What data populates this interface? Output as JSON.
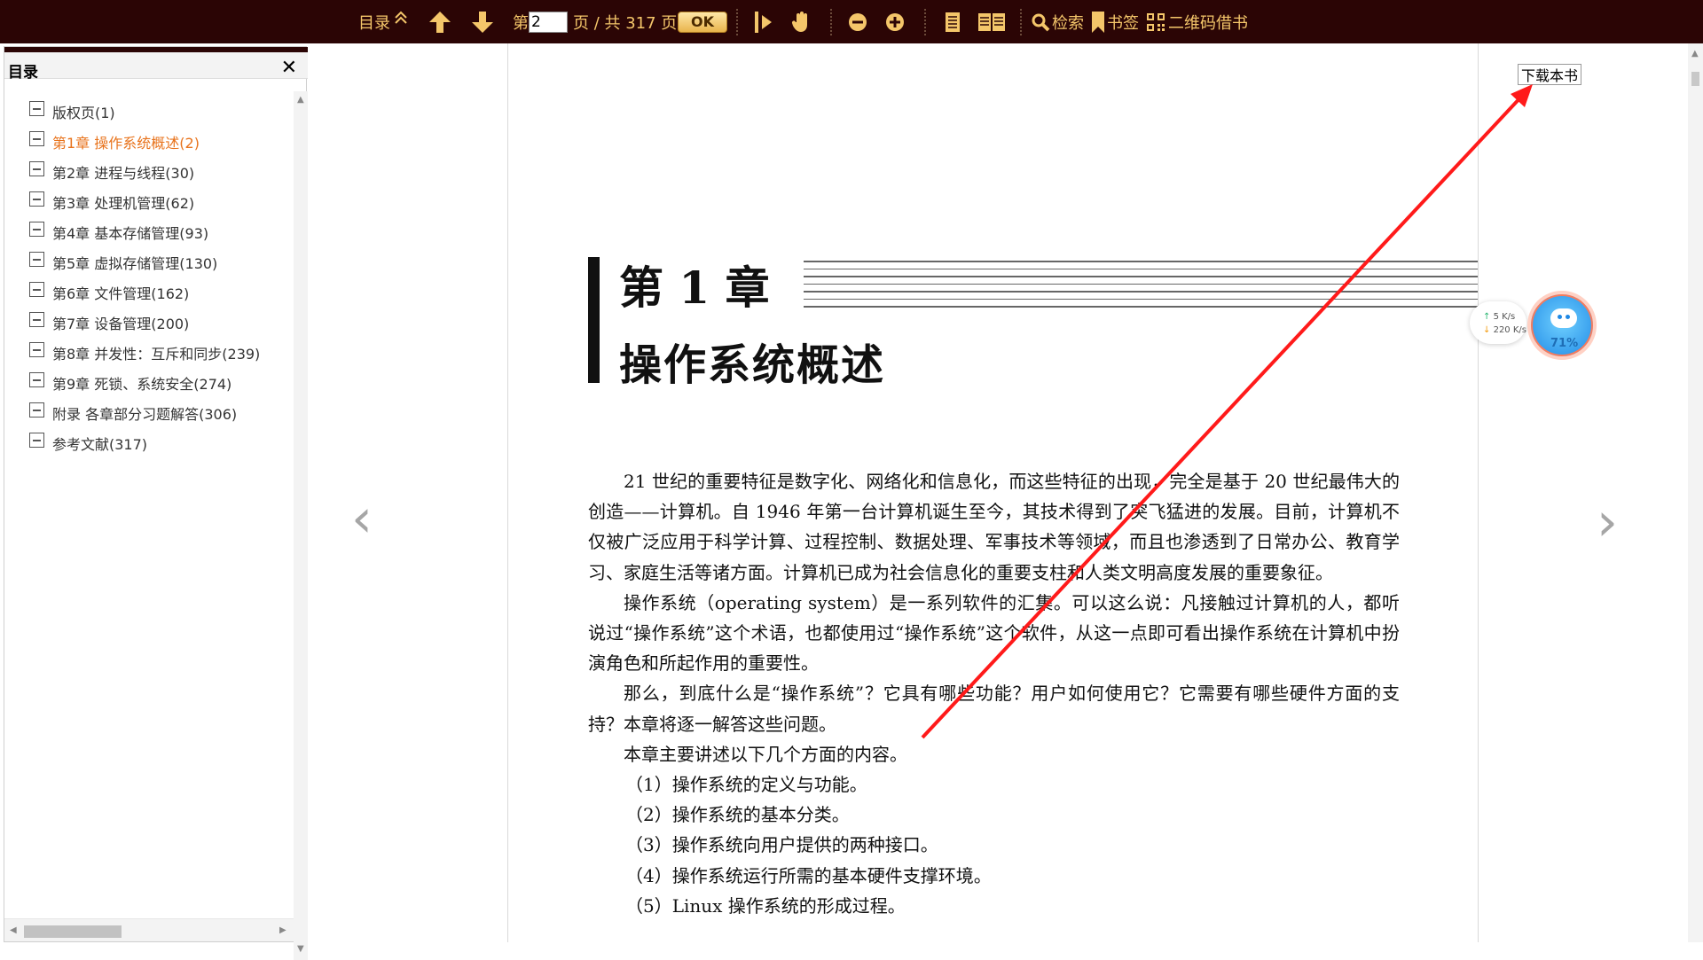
{
  "toolbar": {
    "toc_label": "目录",
    "page_prefix": "第",
    "current_page": "2",
    "page_total_text": "页 / 共 317 页",
    "ok_label": "OK",
    "search_label": "检索",
    "bookmark_label": "书签",
    "qr_label": "二维码借书",
    "icons": [
      "collapse-up-icon",
      "arrow-up-icon",
      "arrow-down-icon",
      "text-select-icon",
      "hand-pan-icon",
      "zoom-out-icon",
      "zoom-in-icon",
      "single-page-icon",
      "double-page-icon",
      "search-icon",
      "bookmark-icon",
      "qr-code-icon"
    ],
    "accent_color": "#f4c66a",
    "bar_color": "#2b0505"
  },
  "sidebar": {
    "title": "目录",
    "items": [
      {
        "label": "版权页(1)",
        "active": false
      },
      {
        "label": "第1章 操作系统概述(2)",
        "active": true
      },
      {
        "label": "第2章 进程与线程(30)",
        "active": false
      },
      {
        "label": "第3章 处理机管理(62)",
        "active": false
      },
      {
        "label": "第4章 基本存储管理(93)",
        "active": false
      },
      {
        "label": "第5章 虚拟存储管理(130)",
        "active": false
      },
      {
        "label": "第6章 文件管理(162)",
        "active": false
      },
      {
        "label": "第7章 设备管理(200)",
        "active": false
      },
      {
        "label": "第8章 并发性：互斥和同步(239)",
        "active": false
      },
      {
        "label": "第9章 死锁、系统安全(274)",
        "active": false
      },
      {
        "label": "附录 各章部分习题解答(306)",
        "active": false
      },
      {
        "label": "参考文献(317)",
        "active": false
      }
    ],
    "active_color": "#e8731c"
  },
  "document": {
    "download_label": "下载本书",
    "chapter_number": "第 1 章",
    "chapter_title": "操作系统概述",
    "paragraphs": [
      "21 世纪的重要特征是数字化、网络化和信息化，而这些特征的出现，完全是基于 20 世纪最伟大的创造——计算机。自 1946 年第一台计算机诞生至今，其技术得到了突飞猛进的发展。目前，计算机不仅被广泛应用于科学计算、过程控制、数据处理、军事技术等领域，而且也渗透到了日常办公、教育学习、家庭生活等诸方面。计算机已成为社会信息化的重要支柱和人类文明高度发展的重要象征。",
      "操作系统（operating system）是一系列软件的汇集。可以这么说：凡接触过计算机的人，都听说过“操作系统”这个术语，也都使用过“操作系统”这个软件，从这一点即可看出操作系统在计算机中扮演角色和所起作用的重要性。",
      "那么，到底什么是“操作系统”？它具有哪些功能？用户如何使用它？它需要有哪些硬件方面的支持？本章将逐一解答这些问题。",
      "本章主要讲述以下几个方面的内容。"
    ],
    "list": [
      "（1）操作系统的定义与功能。",
      "（2）操作系统的基本分类。",
      "（3）操作系统向用户提供的两种接口。",
      "（4）操作系统运行所需的基本硬件支撑环境。",
      "（5）Linux 操作系统的形成过程。"
    ]
  },
  "net_widget": {
    "up_speed": "5   K/s",
    "down_speed": "220 K/s",
    "percent": "71%"
  },
  "annotation_color": "#ff1a1a"
}
